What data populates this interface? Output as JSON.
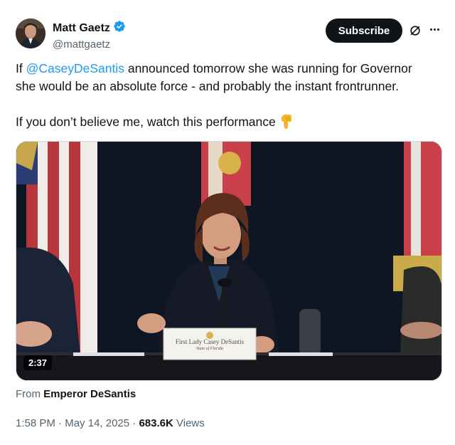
{
  "author": {
    "name": "Matt Gaetz",
    "handle": "@mattgaetz"
  },
  "actions": {
    "subscribe_label": "Subscribe",
    "grok_icon": "grok-icon",
    "more_icon": "more-icon"
  },
  "tweet": {
    "line1_prefix": "If ",
    "mention": "@CaseyDeSantis",
    "line1_suffix": " announced tomorrow she was running for Governor",
    "line2": "she would be an absolute force - and probably the instant frontrunner.",
    "line3": "If you don’t believe me, watch this performance",
    "emoji": "👇"
  },
  "media": {
    "duration": "2:37",
    "nameplate_line1": "First Lady Casey DeSantis",
    "nameplate_line2": "State of Florida"
  },
  "source": {
    "prefix": "From ",
    "name": "Emperor DeSantis"
  },
  "meta": {
    "time": "1:58 PM",
    "sep1": " · ",
    "date": "May 14, 2025",
    "sep2": " · ",
    "views_count": "683.6K",
    "views_label": " Views"
  },
  "colors": {
    "accent": "#1d9bf0",
    "text": "#0f1419",
    "secondary": "#536471",
    "verified": "#1d9bf0"
  }
}
